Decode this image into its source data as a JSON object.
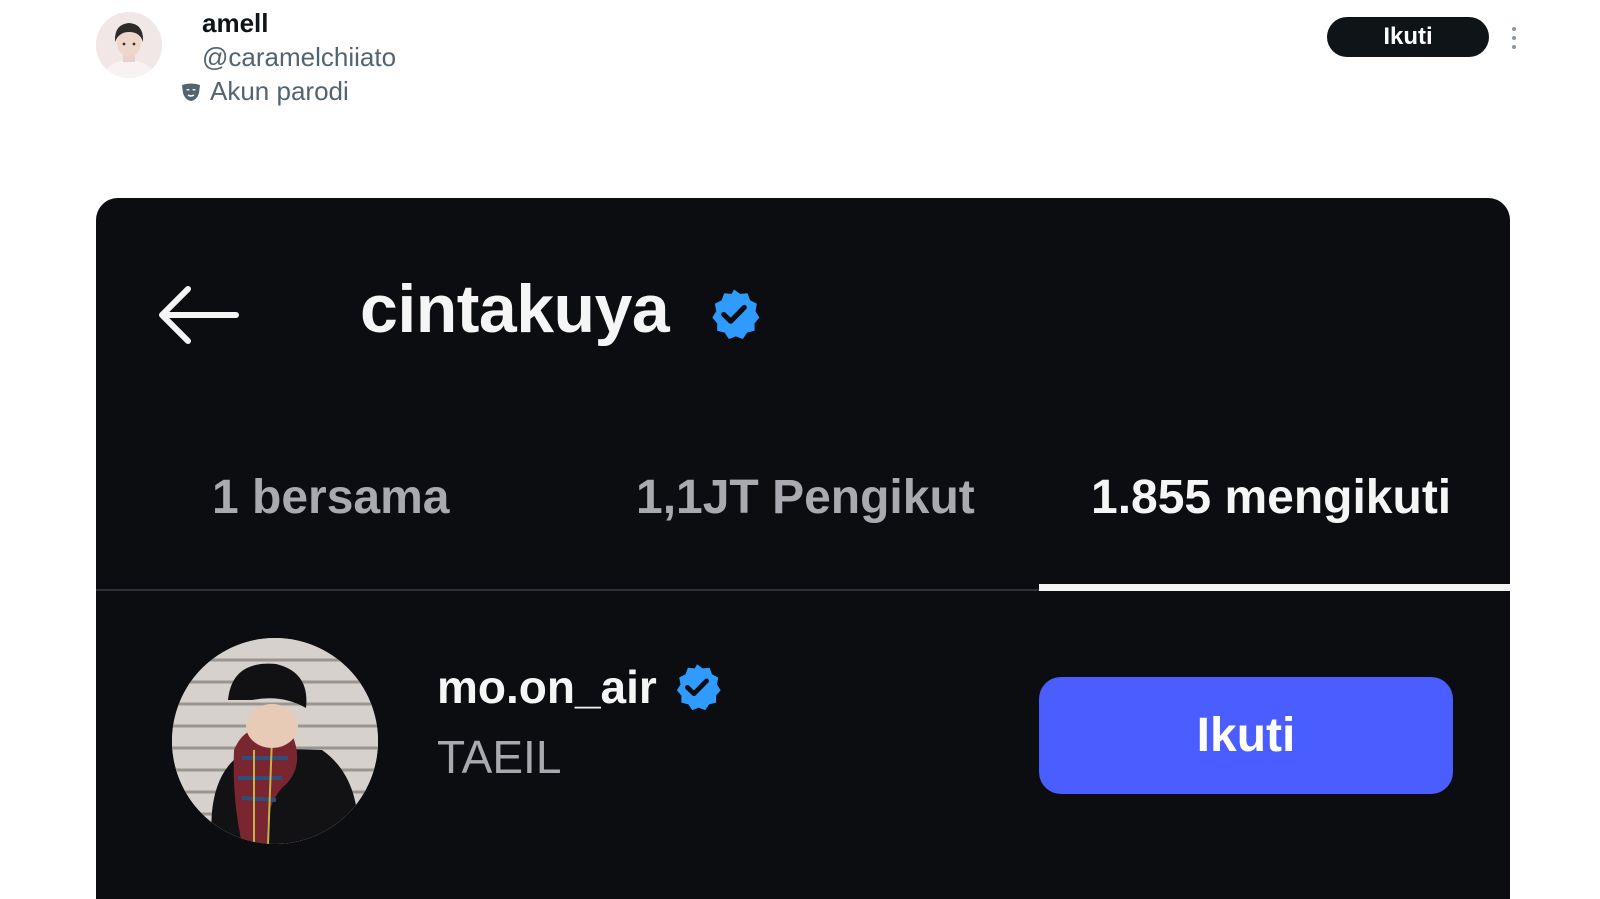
{
  "tweet": {
    "author": {
      "display_name": "amell",
      "handle": "@caramelchiiato",
      "label": "Akun parodi",
      "label_icon": "parody-mask-icon",
      "avatar": "avatar-photo"
    },
    "follow_label": "Ikuti",
    "more_icon": "more-vertical-icon"
  },
  "embedded_screen": {
    "back_icon": "arrow-left-icon",
    "profile_name": "cintakuya",
    "verified_icon": "verified-badge-icon",
    "verified_color": "#2f9bff",
    "tabs": [
      {
        "label": "1 bersama",
        "active": false
      },
      {
        "label": "1,1JT Pengikut",
        "active": false
      },
      {
        "label": "1.855 mengikuti",
        "active": true
      }
    ],
    "list": [
      {
        "handle": "mo.on_air",
        "verified": true,
        "name": "TAEIL",
        "avatar": "user-photo",
        "action_label": "Ikuti",
        "action_color": "#4a5dff"
      }
    ]
  }
}
